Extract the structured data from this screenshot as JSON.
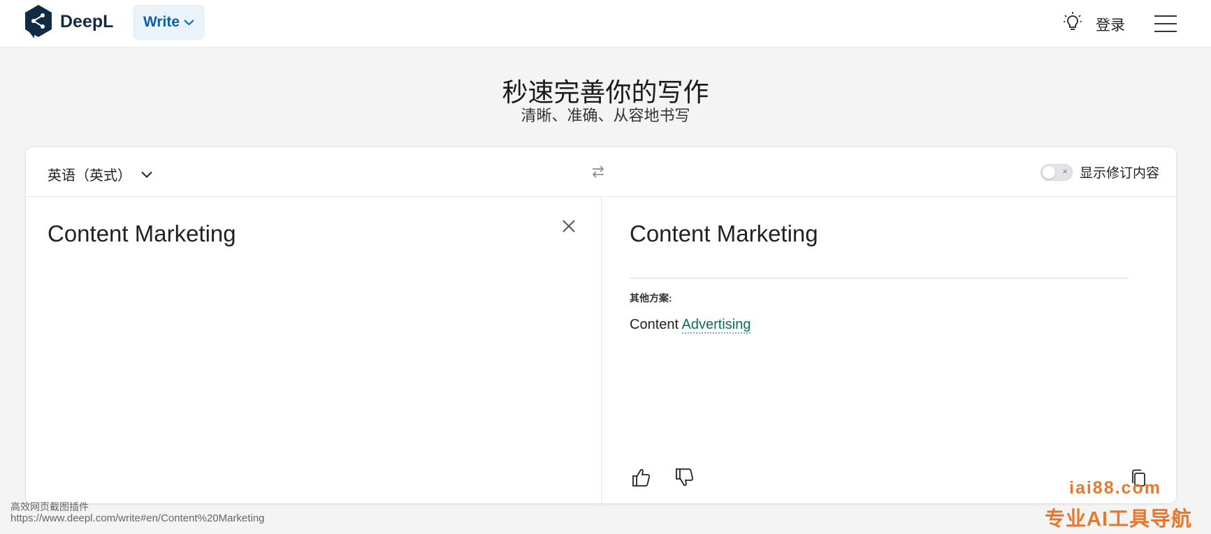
{
  "header": {
    "brand": "DeepL",
    "write_label": "Write",
    "login_label": "登录"
  },
  "hero": {
    "title": "秒速完善你的写作",
    "subtitle": "清晰、准确、从容地书写"
  },
  "toolbar": {
    "language": "英语（英式）",
    "show_changes_label": "显示修订内容",
    "toggle_x": "×"
  },
  "input": {
    "text": "Content Marketing"
  },
  "output": {
    "text": "Content Marketing",
    "alternatives_label": "其他方案:",
    "alternative_plain": "Content ",
    "alternative_changed": "Advertising"
  },
  "status": {
    "line1": "高效网页截图插件",
    "line2": "https://www.deepl.com/write#en/Content%20Marketing"
  },
  "watermark": {
    "line1": "iai88.com",
    "line2": "专业AI工具导航"
  },
  "colors": {
    "brand": "#0f2b46",
    "accent": "#0d5ea7",
    "alt_highlight": "#0e6b5c",
    "watermark": "#e8772e"
  }
}
